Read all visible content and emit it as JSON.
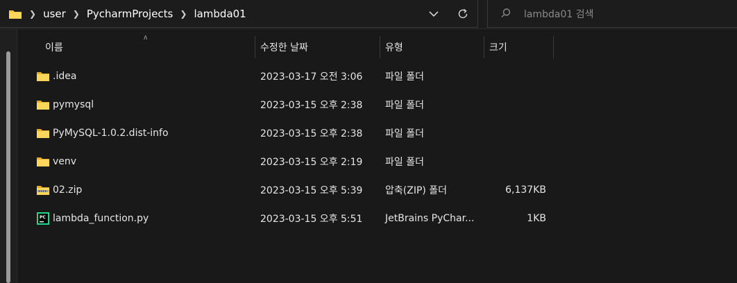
{
  "address": {
    "breadcrumbs": [
      "user",
      "PycharmProjects",
      "lambda01"
    ]
  },
  "search": {
    "placeholder": "lambda01 검색"
  },
  "columns": {
    "name": "이름",
    "date": "수정한 날짜",
    "type": "유형",
    "size": "크기"
  },
  "files": [
    {
      "name": ".idea",
      "date": "2023-03-17 오전 3:06",
      "type": "파일 폴더",
      "size": "",
      "icon": "folder-icon"
    },
    {
      "name": "pymysql",
      "date": "2023-03-15 오후 2:38",
      "type": "파일 폴더",
      "size": "",
      "icon": "folder-icon"
    },
    {
      "name": "PyMySQL-1.0.2.dist-info",
      "date": "2023-03-15 오후 2:38",
      "type": "파일 폴더",
      "size": "",
      "icon": "folder-icon"
    },
    {
      "name": "venv",
      "date": "2023-03-15 오후 2:19",
      "type": "파일 폴더",
      "size": "",
      "icon": "folder-icon"
    },
    {
      "name": "02.zip",
      "date": "2023-03-15 오후 5:39",
      "type": "압축(ZIP) 폴더",
      "size": "6,137KB",
      "icon": "zip-folder-icon"
    },
    {
      "name": "lambda_function.py",
      "date": "2023-03-15 오후 5:51",
      "type": "JetBrains PyChar...",
      "size": "1KB",
      "icon": "pycharm-file-icon"
    }
  ],
  "colors": {
    "background": "#191919",
    "folder": "#f4c542",
    "text": "#e6e6e6"
  }
}
